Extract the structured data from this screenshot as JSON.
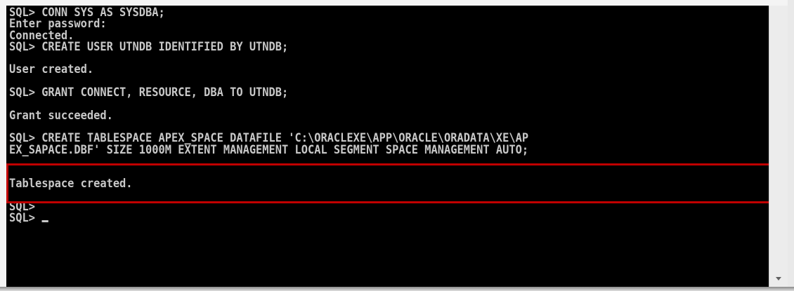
{
  "console": {
    "lines": [
      "SQL> CONN SYS AS SYSDBA;",
      "Enter password:",
      "Connected.",
      "SQL> CREATE USER UTNDB IDENTIFIED BY UTNDB;",
      "",
      "User created.",
      "",
      "SQL> GRANT CONNECT, RESOURCE, DBA TO UTNDB;",
      "",
      "Grant succeeded.",
      "",
      "SQL> CREATE TABLESPACE APEX_SPACE DATAFILE 'C:\\ORACLEXE\\APP\\ORACLE\\ORADATA\\XE\\AP",
      "EX_SAPACE.DBF' SIZE 1000M EXTENT MANAGEMENT LOCAL SEGMENT SPACE MANAGEMENT AUTO;",
      "",
      "",
      "Tablespace created.",
      "",
      "SQL>",
      "SQL> "
    ]
  },
  "colors": {
    "console_background": "#000000",
    "console_text": "#c8c8c8",
    "highlight_border": "#c00000"
  },
  "icons": {
    "scroll_down": "chevron-down-icon"
  }
}
